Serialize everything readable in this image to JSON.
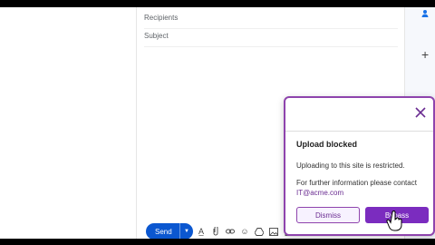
{
  "compose": {
    "recipients_label": "Recipients",
    "subject_label": "Subject",
    "send_label": "Send",
    "send_dropdown_icon": "chevron-down-icon",
    "toolbar_icons": [
      "format-text-icon",
      "attachment-icon",
      "link-icon",
      "emoji-icon",
      "drive-icon",
      "image-icon",
      "lock-icon",
      "signature-icon"
    ]
  },
  "right_rail": {
    "icons": [
      "person-icon",
      "plus-icon"
    ]
  },
  "popup": {
    "title": "Upload blocked",
    "message": "Uploading to this site is restricted.",
    "info_prefix": "For further information please contact ",
    "info_email": "IT@acme.com",
    "dismiss_label": "Dismiss",
    "bypass_label": "Bypass",
    "accent_color": "#8e44ad"
  }
}
